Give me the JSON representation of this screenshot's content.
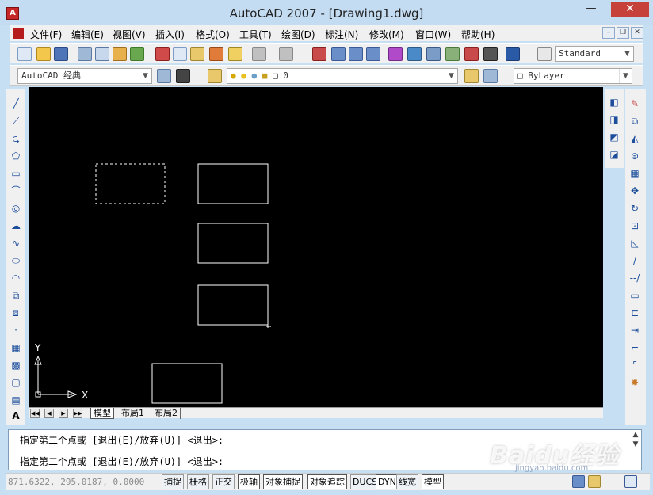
{
  "window": {
    "title": "AutoCAD 2007 - [Drawing1.dwg]",
    "minimize": "—",
    "maximize": "☐",
    "close": "✕",
    "app_icon": "A"
  },
  "menu": {
    "items": [
      "文件(F)",
      "编辑(E)",
      "视图(V)",
      "插入(I)",
      "格式(O)",
      "工具(T)",
      "绘图(D)",
      "标注(N)",
      "修改(M)",
      "窗口(W)",
      "帮助(H)"
    ],
    "mdi_min": "–",
    "mdi_restore": "❐",
    "mdi_close": "✕"
  },
  "toolbar": {
    "text_style": "Standard",
    "workspace": "AutoCAD 经典",
    "layer": "0",
    "color": "ByLayer"
  },
  "canvas": {
    "background": "#000000",
    "ucs_x_label": "X",
    "ucs_y_label": "Y"
  },
  "layout_tabs": {
    "nav": [
      "◀◀",
      "◀",
      "▶",
      "▶▶"
    ],
    "tabs": [
      "模型",
      "布局1",
      "布局2"
    ],
    "active": "模型"
  },
  "command": {
    "history": "指定第二个点或 [退出(E)/放弃(U)] <退出>:",
    "prompt": "指定第二个点或 [退出(E)/放弃(U)] <退出>:",
    "scroll_up": "▲",
    "scroll_down": "▼"
  },
  "status": {
    "coordinates": "871.6322, 295.0187, 0.0000",
    "buttons": [
      "捕捉",
      "栅格",
      "正交",
      "极轴",
      "对象捕捉",
      "对象追踪",
      "DUCS",
      "DYN",
      "线宽",
      "模型"
    ]
  },
  "watermark": {
    "text": "Baidu经验",
    "sub": "jingyan.baidu.com"
  }
}
